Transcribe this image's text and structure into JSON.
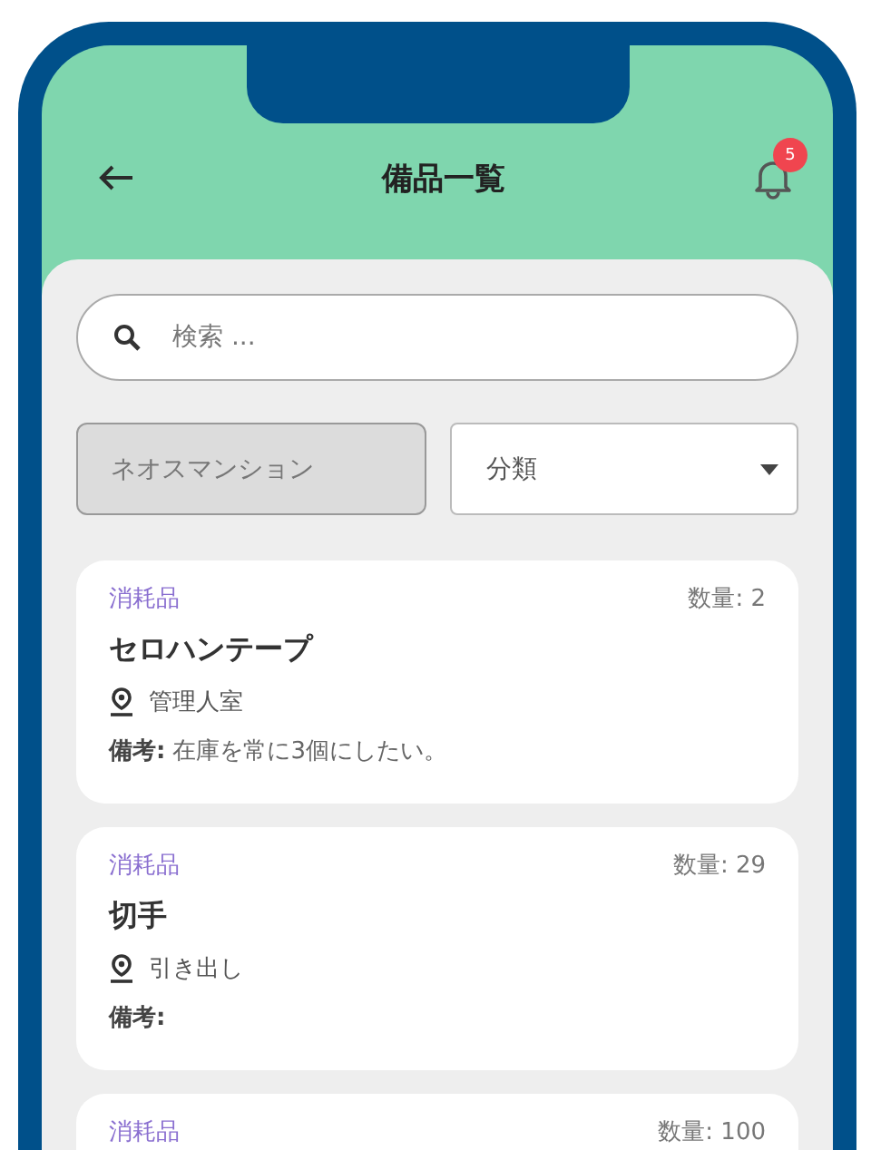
{
  "header": {
    "title": "備品一覧",
    "notification_count": "5"
  },
  "search": {
    "placeholder": "検索 ..."
  },
  "filters": {
    "location_button": "ネオスマンション",
    "category_select": "分類"
  },
  "items": [
    {
      "category": "消耗品",
      "quantity": "数量: 2",
      "name": "セロハンテープ",
      "location": "管理人室",
      "note_label": "備考:",
      "note": "在庫を常に3個にしたい。"
    },
    {
      "category": "消耗品",
      "quantity": "数量: 29",
      "name": "切手",
      "location": "引き出し",
      "note_label": "備考:"
    },
    {
      "category": "消耗品",
      "quantity": "数量: 100"
    }
  ]
}
